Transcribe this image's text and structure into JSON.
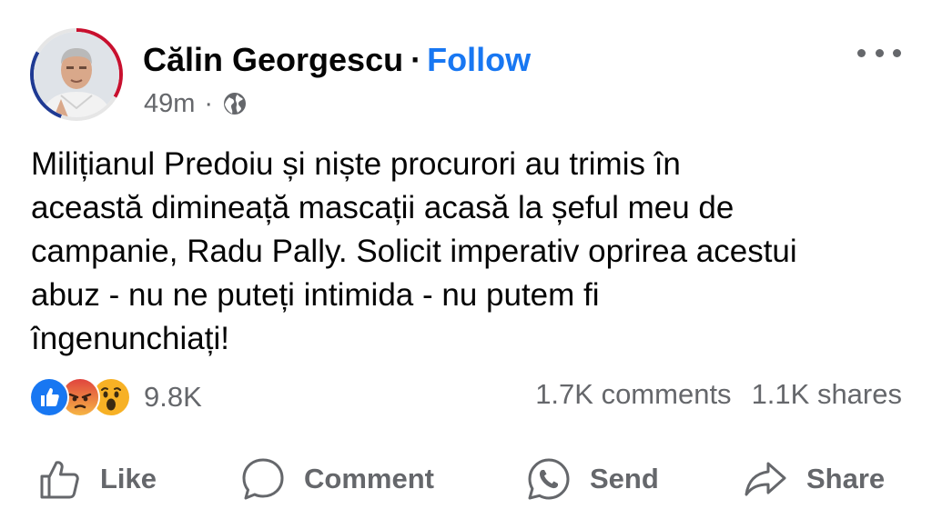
{
  "author": {
    "name": "Călin Georgescu",
    "separator": "·",
    "follow_label": "Follow"
  },
  "meta": {
    "time": "49m",
    "separator": "·",
    "audience_icon": "globe-icon"
  },
  "more_icon": "more-horizontal-icon",
  "post": {
    "text": "Milițianul Predoiu și niște procurori au trimis în\naceastă dimineață mascații acasă la șeful meu de\ncampanie, Radu Pally. Solicit imperativ oprirea acestui\nabuz - nu ne puteți intimida - nu putem fi\nîngenunchiați!"
  },
  "reactions": {
    "types": [
      "like",
      "angry",
      "wow"
    ],
    "count": "9.8K"
  },
  "stats": {
    "comments": "1.7K comments",
    "shares": "1.1K shares"
  },
  "actions": {
    "like_label": "Like",
    "comment_label": "Comment",
    "send_label": "Send",
    "share_label": "Share"
  },
  "colors": {
    "follow": "#1877f2",
    "secondary_text": "#65676b",
    "like_reaction": "#1877f2",
    "angry_reaction": "#e9710f",
    "wow_reaction": "#f7b125"
  }
}
